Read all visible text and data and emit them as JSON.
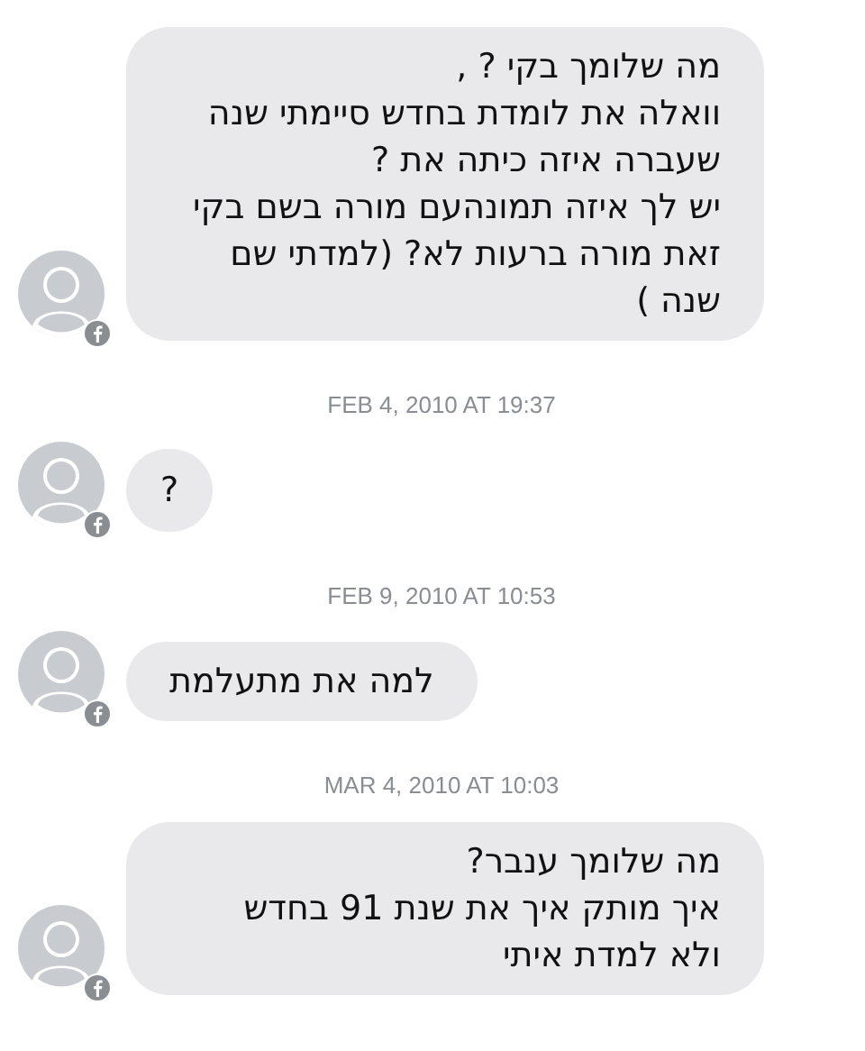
{
  "messages": [
    {
      "kind": "message",
      "text": "מה שלומך בקי ? ,\nוואלה את לומדת בחדש סיימתי שנה\nשעברה איזה כיתה את ?\nיש לך איזה תמונהעם מורה בשם בקי\nזאת מורה ברעות לא? (למדתי שם\nשנה )"
    },
    {
      "kind": "timestamp",
      "text": "FEB 4, 2010 AT 19:37"
    },
    {
      "kind": "message",
      "text": "?"
    },
    {
      "kind": "timestamp",
      "text": "FEB 9, 2010 AT 10:53"
    },
    {
      "kind": "message",
      "text": "למה את מתעלמת"
    },
    {
      "kind": "timestamp",
      "text": "MAR 4, 2010 AT 10:03"
    },
    {
      "kind": "message",
      "text": "מה שלומך ענבר?\nאיך מותק איך את שנת 91 בחדש\nולא למדת איתי"
    }
  ]
}
